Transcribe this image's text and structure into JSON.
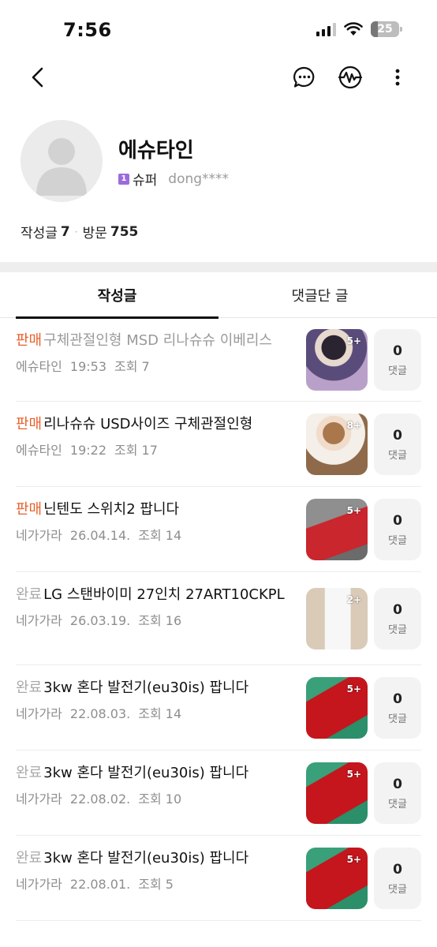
{
  "status_bar": {
    "time": "7:56",
    "battery": "25",
    "battery_level": 0.25
  },
  "nav": {
    "back_icon": "chevron-left-icon",
    "chat_icon": "chat-bubble-icon",
    "wave_icon": "waveform-icon",
    "more_icon": "vertical-dots-icon"
  },
  "profile": {
    "name": "에슈타인",
    "grade_badge": "1",
    "grade": "슈퍼",
    "user_id": "dong****",
    "posts_label": "작성글",
    "posts_count": "7",
    "visits_label": "방문",
    "visits_count": "755"
  },
  "tabs": [
    {
      "label": "작성글",
      "active": true
    },
    {
      "label": "댓글단 글",
      "active": false
    }
  ],
  "posts": [
    {
      "tag": "판매",
      "tag_type": "sale",
      "title": "구체관절인형 MSD 리나슈슈 이베리스",
      "title_faded": true,
      "author": "에슈타인",
      "time": "19:53",
      "views": "조회 7",
      "image_count": "5+",
      "comments": "0",
      "comment_label": "댓글"
    },
    {
      "tag": "판매",
      "tag_type": "sale",
      "title": "리나슈슈 USD사이즈 구체관절인형",
      "title_faded": false,
      "author": "에슈타인",
      "time": "19:22",
      "views": "조회 17",
      "image_count": "8+",
      "comments": "0",
      "comment_label": "댓글"
    },
    {
      "tag": "판매",
      "tag_type": "sale",
      "title": "닌텐도 스위치2 팝니다",
      "title_faded": false,
      "author": "네가가라",
      "time": "26.04.14.",
      "views": "조회 14",
      "image_count": "5+",
      "comments": "0",
      "comment_label": "댓글"
    },
    {
      "tag": "완료",
      "tag_type": "done",
      "title": "LG 스탠바이미 27인치 27ART10CKPL",
      "title_faded": false,
      "author": "네가가라",
      "time": "26.03.19.",
      "views": "조회 16",
      "image_count": "2+",
      "comments": "0",
      "comment_label": "댓글"
    },
    {
      "tag": "완료",
      "tag_type": "done",
      "title": "3kw 혼다 발전기(eu30is) 팝니다",
      "title_faded": false,
      "author": "네가가라",
      "time": "22.08.03.",
      "views": "조회 14",
      "image_count": "5+",
      "comments": "0",
      "comment_label": "댓글"
    },
    {
      "tag": "완료",
      "tag_type": "done",
      "title": "3kw 혼다 발전기(eu30is) 팝니다",
      "title_faded": false,
      "author": "네가가라",
      "time": "22.08.02.",
      "views": "조회 10",
      "image_count": "5+",
      "comments": "0",
      "comment_label": "댓글"
    },
    {
      "tag": "완료",
      "tag_type": "done",
      "title": "3kw 혼다 발전기(eu30is) 팝니다",
      "title_faded": false,
      "author": "네가가라",
      "time": "22.08.01.",
      "views": "조회 5",
      "image_count": "5+",
      "comments": "0",
      "comment_label": "댓글"
    }
  ],
  "colors": {
    "sale_tag": "#e8602c",
    "done_tag": "#aaaaaa",
    "grade_badge": "#9b6bde"
  }
}
